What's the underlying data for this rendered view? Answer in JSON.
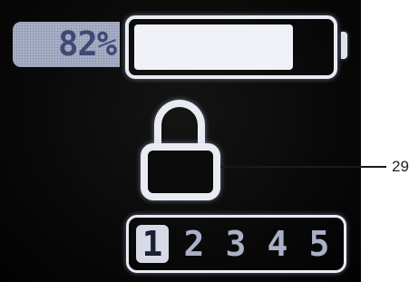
{
  "battery": {
    "percent_label": "82%",
    "level": 0.82
  },
  "lock": {
    "state": "locked",
    "icon": "padlock-icon"
  },
  "callout": {
    "label": "29"
  },
  "slots": {
    "items": [
      {
        "label": "1",
        "active": true
      },
      {
        "label": "2",
        "active": false
      },
      {
        "label": "3",
        "active": false
      },
      {
        "label": "4",
        "active": false
      },
      {
        "label": "5",
        "active": false
      }
    ]
  },
  "colors": {
    "screen_bg": "#070707",
    "outline": "#e9ebf3",
    "chip_bg": "#aab0c6",
    "chip_text": "#3f4a74"
  }
}
